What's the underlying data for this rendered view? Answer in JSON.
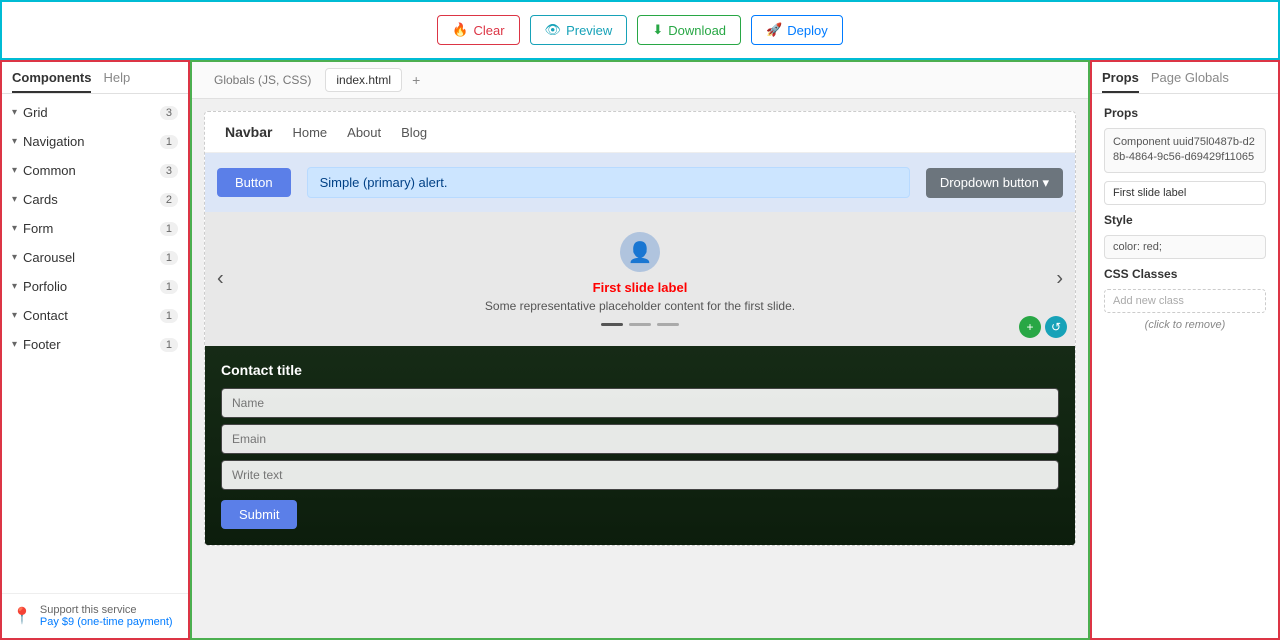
{
  "toolbar": {
    "clear_label": "Clear",
    "preview_label": "Preview",
    "download_label": "Download",
    "deploy_label": "Deploy"
  },
  "left_sidebar": {
    "tabs": [
      {
        "id": "components",
        "label": "Components",
        "active": true
      },
      {
        "id": "help",
        "label": "Help",
        "active": false
      }
    ],
    "items": [
      {
        "id": "grid",
        "label": "Grid",
        "count": 3
      },
      {
        "id": "navigation",
        "label": "Navigation",
        "count": 1
      },
      {
        "id": "common",
        "label": "Common",
        "count": 3
      },
      {
        "id": "cards",
        "label": "Cards",
        "count": 2
      },
      {
        "id": "form",
        "label": "Form",
        "count": 1
      },
      {
        "id": "carousel",
        "label": "Carousel",
        "count": 1
      },
      {
        "id": "porfolio",
        "label": "Porfolio",
        "count": 1
      },
      {
        "id": "contact",
        "label": "Contact",
        "count": 1
      },
      {
        "id": "footer",
        "label": "Footer",
        "count": 1
      }
    ],
    "support": {
      "text": "Support this service",
      "link": "Pay $9 (one-time payment)"
    }
  },
  "canvas": {
    "tabs": [
      {
        "id": "globals",
        "label": "Globals (JS, CSS)",
        "active": false
      },
      {
        "id": "index",
        "label": "index.html",
        "active": true
      },
      {
        "id": "plus",
        "label": "+"
      }
    ],
    "preview": {
      "navbar": {
        "brand": "Navbar",
        "links": [
          "Home",
          "About",
          "Blog"
        ]
      },
      "button_label": "Button",
      "alert_text": "Simple (primary) alert.",
      "dropdown_label": "Dropdown button ▾",
      "carousel": {
        "slide_label": "First slide label",
        "slide_text": "Some representative placeholder content for the first slide.",
        "avatar_icon": "👤"
      },
      "contact": {
        "title": "Contact title",
        "name_placeholder": "Name",
        "email_placeholder": "Emain",
        "textarea_placeholder": "Write text",
        "submit_label": "Submit"
      }
    }
  },
  "right_panel": {
    "tabs": [
      {
        "id": "props",
        "label": "Props",
        "active": true
      },
      {
        "id": "page_globals",
        "label": "Page Globals",
        "active": false
      }
    ],
    "props_title": "Props",
    "component_id": "Component uuid75l0487b-d28b-4864-9c56-d69429f11065",
    "first_slide_label": "First slide label",
    "style_title": "Style",
    "style_value": "color: red;",
    "css_classes_title": "CSS Classes",
    "add_class_placeholder": "Add new class",
    "remove_hint": "(click to remove)"
  }
}
